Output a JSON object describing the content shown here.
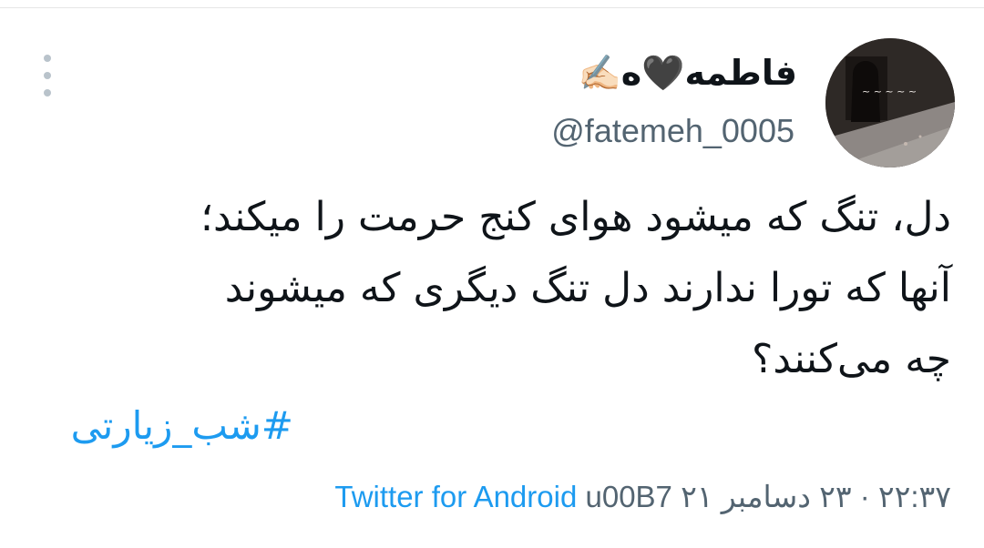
{
  "user": {
    "display_name": "فاطمه🖤ه✍🏻",
    "handle": "@fatemeh_0005"
  },
  "tweet": {
    "lines": [
      "دل، تنگ که میشود هوای کنج حرمت را میکند؛",
      "آنها که تورا ندارند دل تنگ دیگری که میشوند",
      "چه می‌کنند؟"
    ],
    "hashtag": "#شب_زیارتی",
    "source": "Twitter for Android",
    "separator": "u00B7",
    "datetime": "۲۲:۳۷ · ۲۳ دسامبر ۲۱"
  },
  "icons": {
    "more": "more-vertical-icon"
  },
  "colors": {
    "link": "#1d9bf0",
    "secondary": "#536471",
    "text": "#0f1419"
  }
}
